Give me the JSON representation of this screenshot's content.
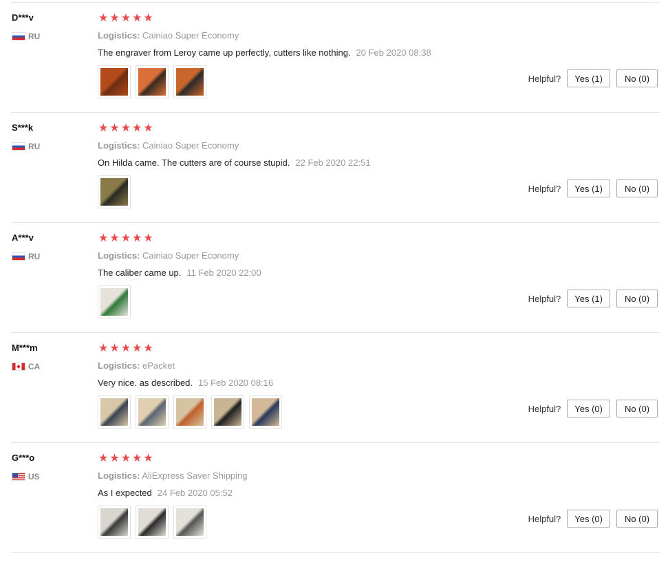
{
  "reviews": [
    {
      "user": "D***v",
      "country": "RU",
      "flag": "ru",
      "rating": 5,
      "logistics_label": "Logistics:",
      "logistics": "Cainiao Super Economy",
      "text": "The engraver from Leroy came up perfectly, cutters like nothing.",
      "date": "20 Feb 2020 08:38",
      "photos": [
        {
          "name": "photo-engraver-bits",
          "colors": [
            "#b34a1a",
            "#6b2d10"
          ]
        },
        {
          "name": "photo-engraver-hand",
          "colors": [
            "#d9703a",
            "#3a2a20"
          ]
        },
        {
          "name": "photo-engraver-body",
          "colors": [
            "#c9662b",
            "#2b2b2b"
          ]
        }
      ],
      "helpful_label": "Helpful?",
      "yes": "Yes (1)",
      "no": "No (0)"
    },
    {
      "user": "S***k",
      "country": "RU",
      "flag": "ru",
      "rating": 5,
      "logistics_label": "Logistics:",
      "logistics": "Cainiao Super Economy",
      "text": "On Hilda came. The cutters are of course stupid.",
      "date": "22 Feb 2020 22:51",
      "photos": [
        {
          "name": "photo-cutters-carpet",
          "colors": [
            "#8a7a4a",
            "#2a2a22"
          ]
        }
      ],
      "helpful_label": "Helpful?",
      "yes": "Yes (1)",
      "no": "No (0)"
    },
    {
      "user": "A***v",
      "country": "RU",
      "flag": "ru",
      "rating": 5,
      "logistics_label": "Logistics:",
      "logistics": "Cainiao Super Economy",
      "text": "The caliber came up.",
      "date": "11 Feb 2020 22:00",
      "photos": [
        {
          "name": "photo-caliber",
          "colors": [
            "#e6e2da",
            "#2f7a3a"
          ]
        }
      ],
      "helpful_label": "Helpful?",
      "yes": "Yes (1)",
      "no": "No (0)"
    },
    {
      "user": "M***m",
      "country": "CA",
      "flag": "ca",
      "rating": 5,
      "logistics_label": "Logistics:",
      "logistics": "ePacket",
      "text": "Very nice. as described.",
      "date": "15 Feb 2020 08:16",
      "photos": [
        {
          "name": "photo-tool-1",
          "colors": [
            "#d8c7a8",
            "#3a4250"
          ]
        },
        {
          "name": "photo-tool-2",
          "colors": [
            "#e0cfb0",
            "#5a6470"
          ]
        },
        {
          "name": "photo-tool-3",
          "colors": [
            "#d6c3a2",
            "#c0602a"
          ]
        },
        {
          "name": "photo-tool-4",
          "colors": [
            "#c8b594",
            "#1f1f1f"
          ]
        },
        {
          "name": "photo-tool-5",
          "colors": [
            "#d4b898",
            "#2a3a5a"
          ]
        }
      ],
      "helpful_label": "Helpful?",
      "yes": "Yes (0)",
      "no": "No (0)"
    },
    {
      "user": "G***o",
      "country": "US",
      "flag": "us",
      "rating": 5,
      "logistics_label": "Logistics:",
      "logistics": "AliExpress Saver Shipping",
      "text": "As I expected",
      "date": "24 Feb 2020 05:52",
      "photos": [
        {
          "name": "photo-item-1",
          "colors": [
            "#d9d6cf",
            "#3a3a3a"
          ]
        },
        {
          "name": "photo-item-2",
          "colors": [
            "#e1ddd4",
            "#2a2a2a"
          ]
        },
        {
          "name": "photo-item-3",
          "colors": [
            "#e4e1da",
            "#555555"
          ]
        }
      ],
      "helpful_label": "Helpful?",
      "yes": "Yes (0)",
      "no": "No (0)"
    }
  ]
}
